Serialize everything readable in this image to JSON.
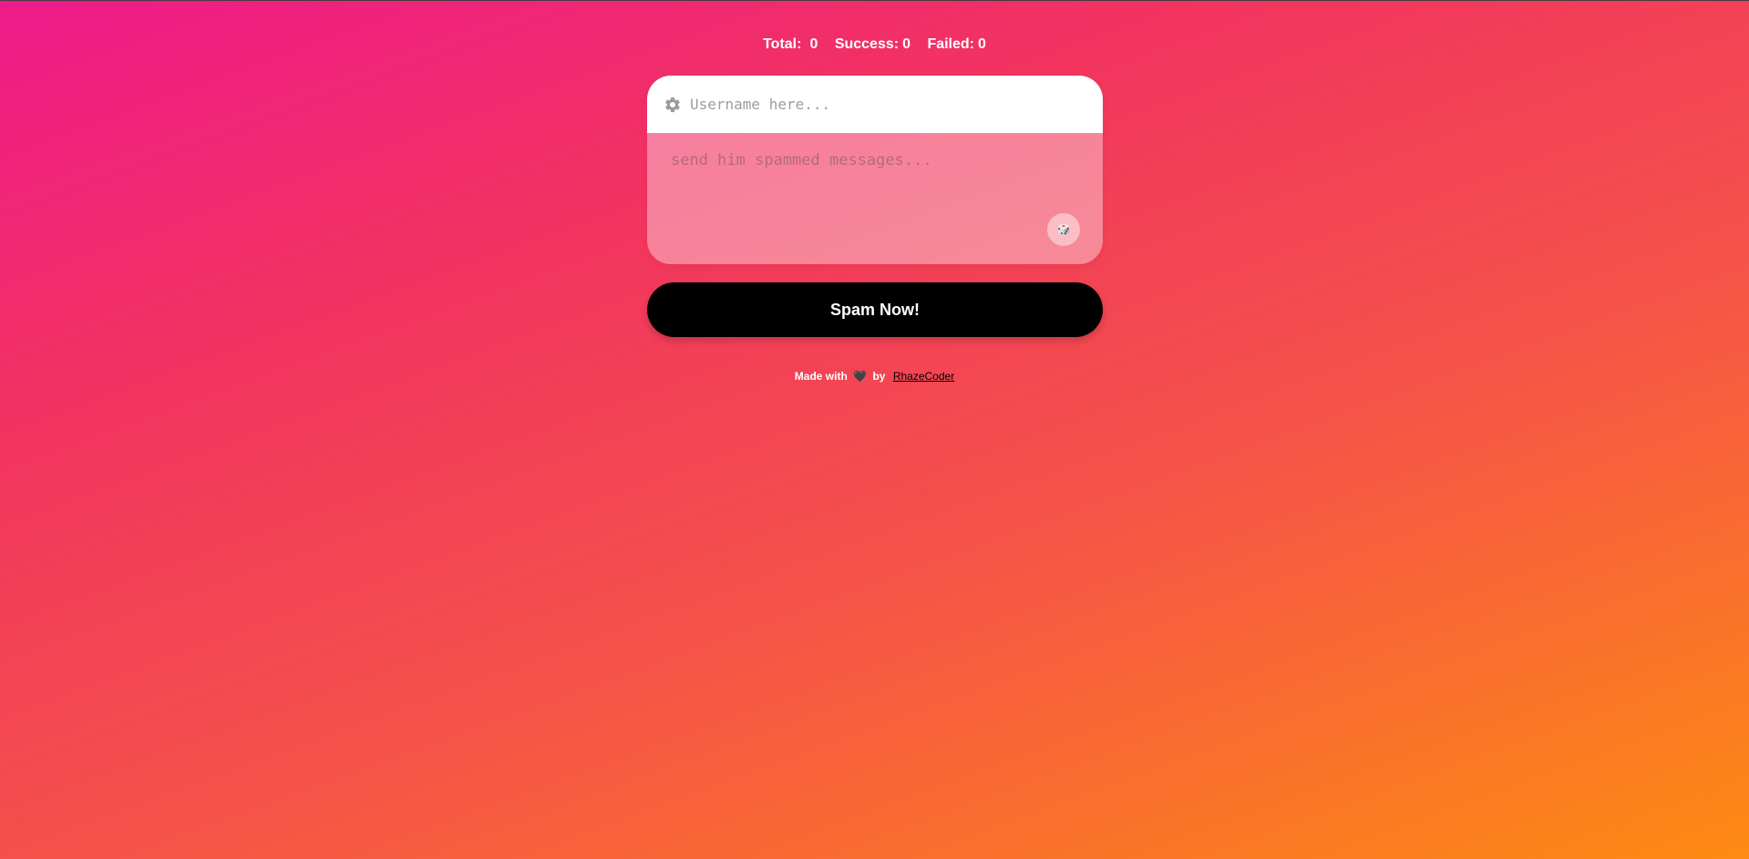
{
  "stats": {
    "total_label": "Total:",
    "total_value": "0",
    "success_label": "Success:",
    "success_value": "0",
    "failed_label": "Failed:",
    "failed_value": "0"
  },
  "form": {
    "username_icon": "gear-icon",
    "username_placeholder": "Username here...",
    "username_value": "",
    "message_placeholder": "send him spammed messages...",
    "message_value": "",
    "dice_icon": "dice-icon",
    "dice_glyph": "🎲"
  },
  "actions": {
    "spam_label": "Spam Now!"
  },
  "footer": {
    "made_with": "Made with",
    "heart_icon": "heart-icon",
    "heart_glyph": "🖤",
    "by": "by",
    "author": "RhazeCoder"
  },
  "colors": {
    "gradient_start": "#ee1a8a",
    "gradient_end": "#fe8a12",
    "button_bg": "#000000"
  }
}
